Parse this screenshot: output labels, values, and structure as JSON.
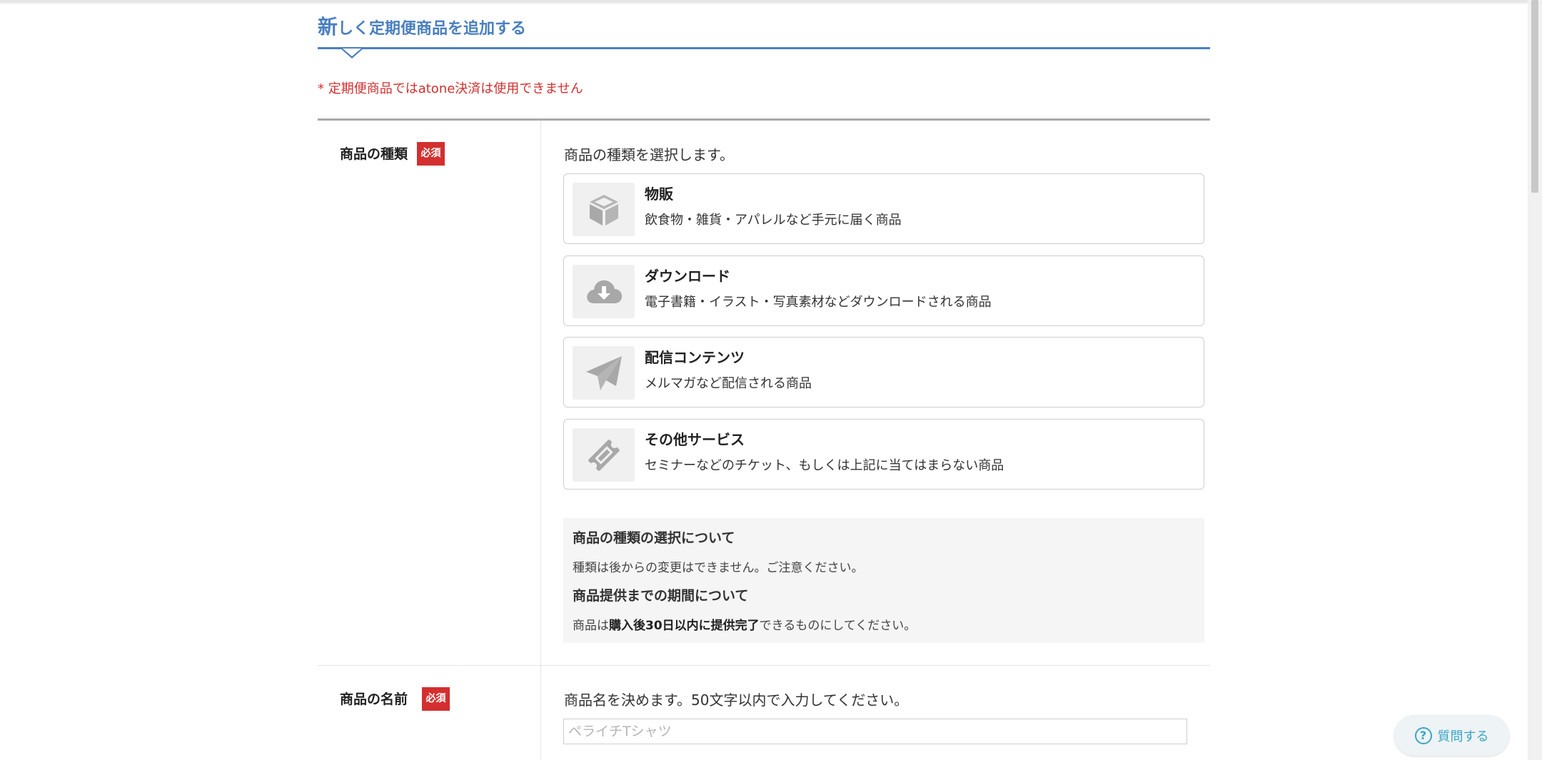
{
  "header": {
    "title_first": "新",
    "title_rest": "しく定期便商品を追加する"
  },
  "notice": "* 定期便商品ではatone決済は使用できません",
  "product_type": {
    "label": "商品の種類",
    "required_badge": "必須",
    "description": "商品の種類を選択します。",
    "options": [
      {
        "title": "物販",
        "subtitle": "飲食物・雑貨・アパレルなど手元に届く商品",
        "icon": "box-icon"
      },
      {
        "title": "ダウンロード",
        "subtitle": "電子書籍・イラスト・写真素材などダウンロードされる商品",
        "icon": "cloud-download-icon"
      },
      {
        "title": "配信コンテンツ",
        "subtitle": "メルマガなど配信される商品",
        "icon": "paper-plane-icon"
      },
      {
        "title": "その他サービス",
        "subtitle": "セミナーなどのチケット、もしくは上記に当てはまらない商品",
        "icon": "ticket-icon"
      }
    ],
    "info": {
      "heading1": "商品の種類の選択について",
      "text1": "種類は後からの変更はできません。ご注意ください。",
      "heading2": "商品提供までの期間について",
      "text2_prefix": "商品は",
      "text2_bold": "購入後30日以内に提供完了",
      "text2_suffix": "できるものにしてください。"
    }
  },
  "product_name": {
    "label": "商品の名前",
    "required_badge": "必須",
    "description": "商品名を決めます。50文字以内で入力してください。",
    "placeholder": "ペライチTシャツ",
    "value": ""
  },
  "help_button": {
    "label": "質問する",
    "icon": "question-circle-icon",
    "color": "#3aa5c7"
  },
  "colors": {
    "accent": "#4a7fbf",
    "required": "#d32f2f"
  }
}
